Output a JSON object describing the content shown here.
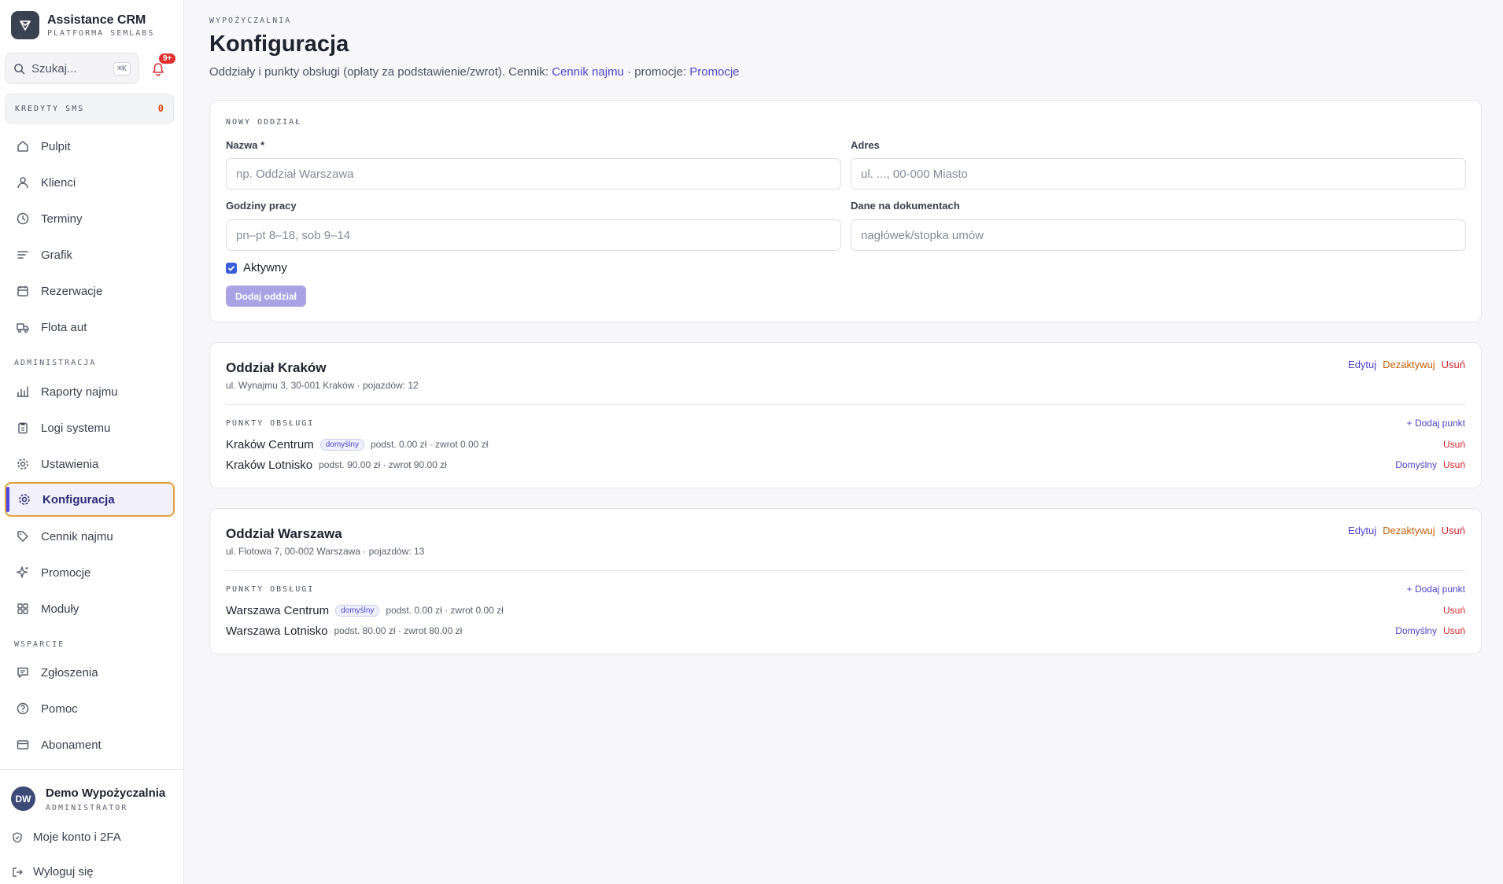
{
  "brand": {
    "title": "Assistance CRM",
    "subtitle": "PLATFORMA SEMLABS"
  },
  "search": {
    "placeholder": "Szukaj...",
    "shortcut": "⌘K"
  },
  "notifications": {
    "badge": "9+"
  },
  "credits": {
    "label": "KREDYTY SMS",
    "value": "0"
  },
  "nav": {
    "main": [
      {
        "label": "Pulpit",
        "icon": "home-icon"
      },
      {
        "label": "Klienci",
        "icon": "user-icon"
      },
      {
        "label": "Terminy",
        "icon": "clock-icon"
      },
      {
        "label": "Grafik",
        "icon": "lines-icon"
      },
      {
        "label": "Rezerwacje",
        "icon": "calendar-icon"
      },
      {
        "label": "Flota aut",
        "icon": "truck-icon"
      }
    ],
    "admin_label": "ADMINISTRACJA",
    "admin": [
      {
        "label": "Raporty najmu",
        "icon": "bar-chart-icon"
      },
      {
        "label": "Logi systemu",
        "icon": "clipboard-icon"
      },
      {
        "label": "Ustawienia",
        "icon": "gear-icon"
      },
      {
        "label": "Konfiguracja",
        "icon": "gear-icon",
        "active": true
      },
      {
        "label": "Cennik najmu",
        "icon": "tag-icon"
      },
      {
        "label": "Promocje",
        "icon": "sparkle-icon"
      },
      {
        "label": "Moduły",
        "icon": "grid-icon"
      }
    ],
    "support_label": "WSPARCIE",
    "support": [
      {
        "label": "Zgłoszenia",
        "icon": "message-icon"
      },
      {
        "label": "Pomoc",
        "icon": "help-icon"
      },
      {
        "label": "Abonament",
        "icon": "card-icon"
      }
    ]
  },
  "user": {
    "initials": "DW",
    "name": "Demo Wypożyczalnia",
    "role": "ADMINISTRATOR"
  },
  "footer": {
    "account": "Moje konto i 2FA",
    "logout": "Wyloguj się"
  },
  "page": {
    "eyebrow": "WYPOŻYCZALNIA",
    "title": "Konfiguracja",
    "desc_prefix": "Oddziały i punkty obsługi (opłaty za podstawienie/zwrot). Cennik: ",
    "desc_link1": "Cennik najmu",
    "desc_mid": " · promocje: ",
    "desc_link2": "Promocje"
  },
  "new_branch": {
    "section_label": "NOWY ODDZIAŁ",
    "name_label": "Nazwa *",
    "name_placeholder": "np. Oddział Warszawa",
    "address_label": "Adres",
    "address_placeholder": "ul. ..., 00-000 Miasto",
    "hours_label": "Godziny pracy",
    "hours_placeholder": "pn–pt 8–18, sob 9–14",
    "docs_label": "Dane na dokumentach",
    "docs_placeholder": "nagłówek/stopka umów",
    "active_label": "Aktywny",
    "active_checked": true,
    "submit_label": "Dodaj oddział"
  },
  "labels": {
    "edit": "Edytuj",
    "deactivate": "Dezaktywuj",
    "delete": "Usuń",
    "points": "PUNKTY OBSŁUGI",
    "add_point": "+ Dodaj punkt",
    "default_pill": "domyślny",
    "set_default": "Domyślny"
  },
  "branches": [
    {
      "name": "Oddział Kraków",
      "meta": "ul. Wynajmu 3, 30-001 Kraków · pojazdów: 12",
      "points": [
        {
          "name": "Kraków Centrum",
          "is_default": true,
          "fees": "podst. 0.00 zł · zwrot 0.00 zł"
        },
        {
          "name": "Kraków Lotnisko",
          "is_default": false,
          "fees": "podst. 90.00 zł · zwrot 90.00 zł"
        }
      ]
    },
    {
      "name": "Oddział Warszawa",
      "meta": "ul. Flotowa 7, 00-002 Warszawa · pojazdów: 13",
      "points": [
        {
          "name": "Warszawa Centrum",
          "is_default": true,
          "fees": "podst. 0.00 zł · zwrot 0.00 zł"
        },
        {
          "name": "Warszawa Lotnisko",
          "is_default": false,
          "fees": "podst. 80.00 zł · zwrot 80.00 zł"
        }
      ]
    }
  ]
}
